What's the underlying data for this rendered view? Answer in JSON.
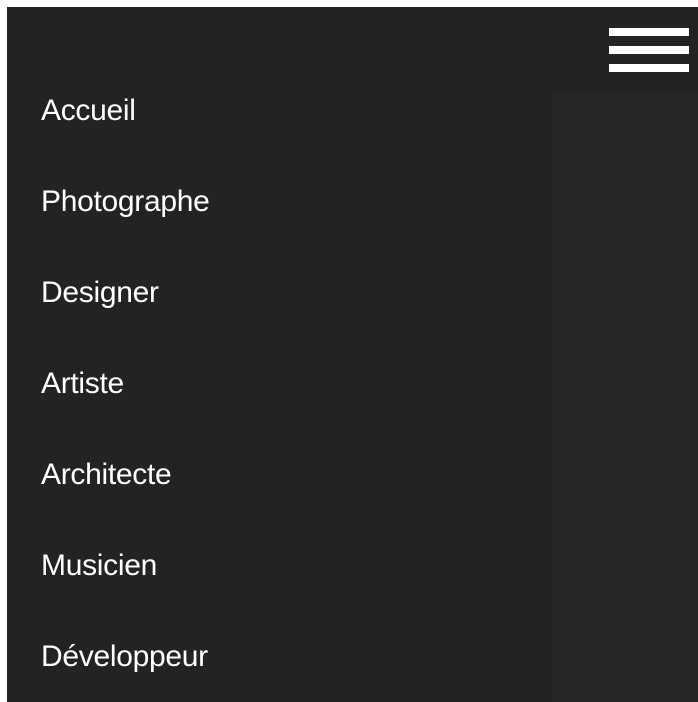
{
  "header": {
    "menu_icon": "hamburger-menu-icon"
  },
  "menu": {
    "items": [
      {
        "label": "Accueil"
      },
      {
        "label": "Photographe"
      },
      {
        "label": "Designer"
      },
      {
        "label": "Artiste"
      },
      {
        "label": "Architecte"
      },
      {
        "label": "Musicien"
      },
      {
        "label": "Développeur"
      }
    ]
  },
  "colors": {
    "page_background": "#272727",
    "header_background": "#232323",
    "menu_background": "#232323",
    "text": "#ffffff"
  }
}
